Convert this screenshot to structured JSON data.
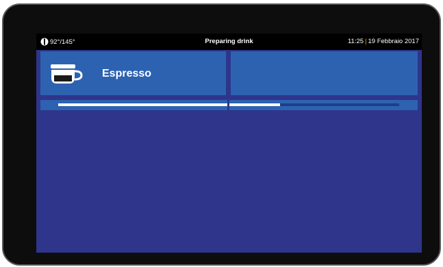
{
  "status_bar": {
    "temperature": "92°/145°",
    "title": "Preparing drink",
    "time": "11:25",
    "separator": "|",
    "date": "19 Febbraio 2017"
  },
  "drink": {
    "name": "Espresso",
    "icon": "espresso-cup-icon"
  },
  "progress": {
    "fraction": 0.65
  },
  "colors": {
    "screen_background": "#2e358b",
    "tile": "#2d62b1",
    "status_bar": "#000000",
    "accent_separator": "#f2a81d",
    "progress_fill": "#ffffff"
  }
}
